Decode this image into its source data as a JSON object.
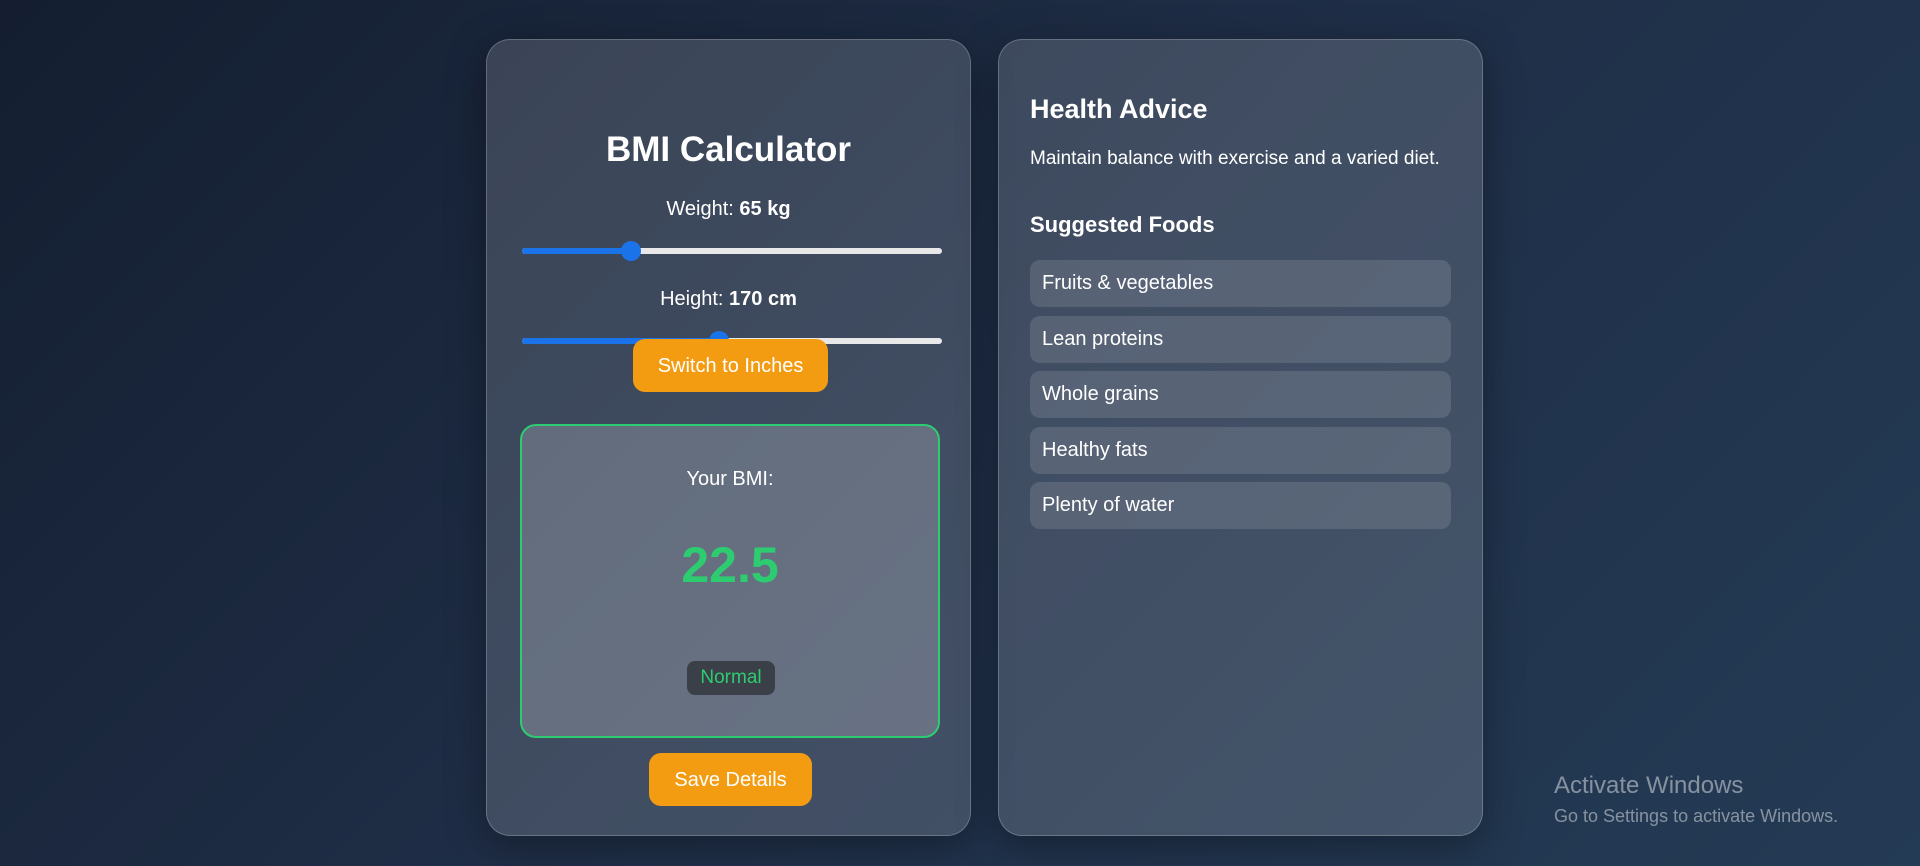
{
  "calculator": {
    "title": "BMI Calculator",
    "weight_label": "Weight:",
    "weight_value": "65 kg",
    "weight_fraction": 0.26,
    "height_label": "Height:",
    "height_value": "170 cm",
    "height_fraction": 0.47,
    "switch_button": "Switch to Inches",
    "result_label": "Your BMI:",
    "bmi_value": "22.5",
    "category": "Normal",
    "save_button": "Save Details"
  },
  "advice": {
    "title": "Health Advice",
    "text": "Maintain balance with exercise and a varied diet.",
    "foods_title": "Suggested Foods",
    "foods": [
      "Fruits & vegetables",
      "Lean proteins",
      "Whole grains",
      "Healthy fats",
      "Plenty of water"
    ]
  },
  "watermark": {
    "title": "Activate Windows",
    "subtitle": "Go to Settings to activate Windows."
  },
  "colors": {
    "accent_button": "#f39c12",
    "slider": "#1a73e8",
    "status_normal": "#2ecc71"
  }
}
